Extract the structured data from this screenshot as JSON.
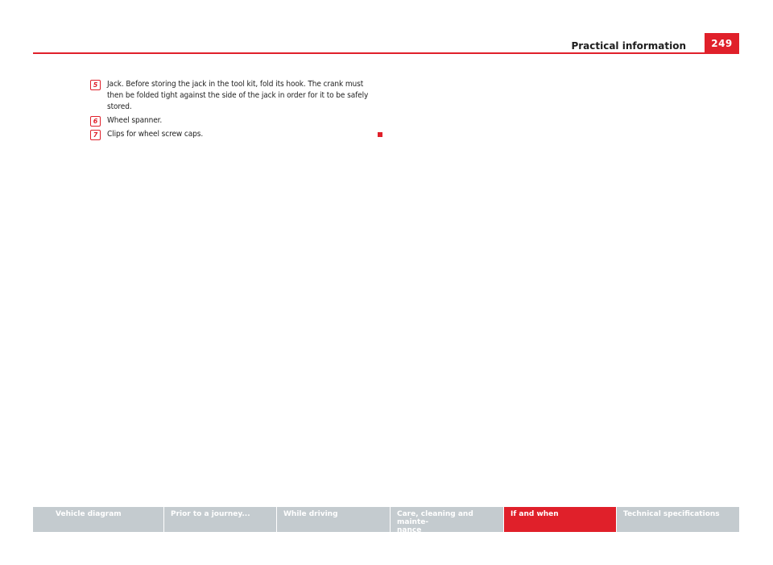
{
  "header": {
    "section_title": "Practical information",
    "page_number": "249",
    "accent_color": "#e0202a"
  },
  "items": [
    {
      "number": "5",
      "text": "Jack. Before storing the jack in the tool kit, fold its hook. The crank must then be folded tight against the side of the jack in order for it to be safely stored."
    },
    {
      "number": "6",
      "text": "Wheel spanner."
    },
    {
      "number": "7",
      "text": "Clips for wheel screw caps."
    }
  ],
  "footer": {
    "tabs": [
      {
        "label": "Vehicle diagram",
        "active": false
      },
      {
        "label": "Prior to a journey...",
        "active": false
      },
      {
        "label": "While driving",
        "active": false
      },
      {
        "label": "Care, cleaning and mainte-\nnance",
        "active": false
      },
      {
        "label": "If and when",
        "active": true
      },
      {
        "label": "Technical specifications",
        "active": false
      }
    ],
    "tab_color": "#c4cbcf",
    "active_color": "#e0202a"
  }
}
